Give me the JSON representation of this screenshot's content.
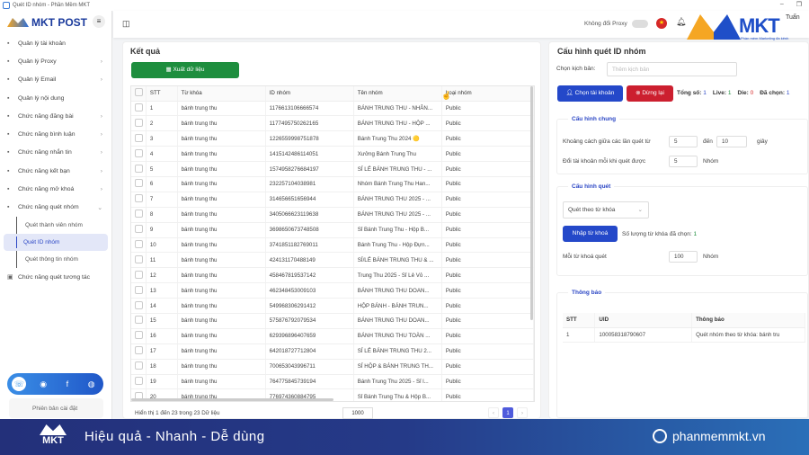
{
  "window": {
    "title": "Quét ID nhóm - Phần Mềm MKT",
    "minimize": "–",
    "restore": "❐"
  },
  "sidebar": {
    "logo": "MKT POST",
    "items": [
      {
        "label": "Quản lý tài khoản",
        "icon": "grid-icon",
        "chevron": false
      },
      {
        "label": "Quản lý Proxy",
        "icon": "gear-icon",
        "chevron": true
      },
      {
        "label": "Quản lý Email",
        "icon": "mail-icon",
        "chevron": true
      },
      {
        "label": "Quản lý nội dung",
        "icon": "content-icon",
        "chevron": false
      },
      {
        "label": "Chức năng đăng bài",
        "icon": "post-icon",
        "chevron": true
      },
      {
        "label": "Chức năng bình luận",
        "icon": "comment-icon",
        "chevron": true
      },
      {
        "label": "Chức năng nhắn tin",
        "icon": "message-icon",
        "chevron": true
      },
      {
        "label": "Chức năng kết bạn",
        "icon": "add-friend-icon",
        "chevron": true
      },
      {
        "label": "Chức năng mở khoá",
        "icon": "unlock-icon",
        "chevron": true
      },
      {
        "label": "Chức năng quét nhóm",
        "icon": "group-icon",
        "chevron": "down"
      }
    ],
    "subitems": [
      "Quét thành viên nhóm",
      "Quét ID nhóm",
      "Quét thông tin nhóm"
    ],
    "active_subitem": "Quét ID nhóm",
    "last_item": "Chức năng quét tương tác",
    "version_label": "Phiên bản cài đặt"
  },
  "topbar": {
    "proxy_label": "Không đổi Proxy",
    "proxy_toggle": false,
    "brand": "MKT",
    "brand_sub": "Phần mềm Marketing đa kênh",
    "user": "Tuấn"
  },
  "results": {
    "title": "Kết quả",
    "export_label": "Xuất dữ liệu",
    "columns": [
      "STT",
      "Từ khóa",
      "ID nhóm",
      "Tên nhóm",
      "Loại nhóm"
    ],
    "rows": [
      [
        "1",
        "bánh trung thu",
        "1176613106666574",
        "BÁNH TRUNG THU - NHÂN...",
        "Public"
      ],
      [
        "2",
        "bánh trung thu",
        "1177495750262165",
        "BÁNH TRUNG THU - HỘP ...",
        "Public"
      ],
      [
        "3",
        "bánh trung thu",
        "1226559998751878",
        "Bánh Trung Thu 2024 🟡",
        "Public"
      ],
      [
        "4",
        "bánh trung thu",
        "1415142486114051",
        "Xưởng Bánh Trung Thu",
        "Public"
      ],
      [
        "5",
        "bánh trung thu",
        "1574958276684197",
        "SỈ LẺ BÁNH TRUNG THU - ...",
        "Public"
      ],
      [
        "6",
        "bánh trung thu",
        "232257104038981",
        "Nhóm Bánh Trung Thu Han...",
        "Public"
      ],
      [
        "7",
        "bánh trung thu",
        "314656651656944",
        "BÁNH TRUNG THU 2025 - ...",
        "Public"
      ],
      [
        "8",
        "bánh trung thu",
        "3405066623119638",
        "BÁNH TRUNG THU 2025 - ...",
        "Public"
      ],
      [
        "9",
        "bánh trung thu",
        "3698650673748508",
        "Sỉ Bánh Trung Thu - Hộp B...",
        "Public"
      ],
      [
        "10",
        "bánh trung thu",
        "374185118276901​1",
        "Bánh Trung Thu - Hộp Đựn...",
        "Public"
      ],
      [
        "11",
        "bánh trung thu",
        "424131170488149",
        "SỈ/LẺ BÁNH TRUNG THU & ...",
        "Public"
      ],
      [
        "12",
        "bánh trung thu",
        "458467819537142",
        "Trung Thu 2025 - Sỉ Lẻ Vỏ ...",
        "Public"
      ],
      [
        "13",
        "bánh trung thu",
        "462348453009103",
        "BÁNH TRUNG THU DOAN...",
        "Public"
      ],
      [
        "14",
        "bánh trung thu",
        "549968306291412",
        "HỘP BÁNH - BÁNH TRUN...",
        "Public"
      ],
      [
        "15",
        "bánh trung thu",
        "575876792079534",
        "BÁNH TRUNG THU DOAN...",
        "Public"
      ],
      [
        "16",
        "bánh trung thu",
        "629396896407659",
        "BÁNH TRUNG THU TOÀN ...",
        "Public"
      ],
      [
        "17",
        "bánh trung thu",
        "642018727712804",
        "SỈ LẺ BÁNH TRUNG THU 2...",
        "Public"
      ],
      [
        "18",
        "bánh trung thu",
        "700653043996711",
        "SỈ HỘP & BÁNH TRUNG TH...",
        "Public"
      ],
      [
        "19",
        "bánh trung thu",
        "764775845739194",
        "Bánh Trung Thu 2025 - Sỉ l...",
        "Public"
      ],
      [
        "20",
        "bánh trung thu",
        "776974360884795",
        "Sỉ Bánh Trung Thu & Hộp B...",
        "Public"
      ]
    ],
    "footer": "Hiển thị 1 đến 23 trong 23 Dữ liệu",
    "page_size": "1000",
    "current_page": "1",
    "prev": "‹",
    "next": "›"
  },
  "config": {
    "title": "Cấu hình quét ID nhóm",
    "script_label": "Chọn kịch bản:",
    "script_placeholder": "Thêm kịch bản",
    "choose_account": "Chọn tài khoản",
    "stop": "Dừng lại",
    "stats": [
      {
        "label": "Tổng số:",
        "value": "1",
        "color": "#2c47c5"
      },
      {
        "label": "Live:",
        "value": "1",
        "color": "#1e8e3e"
      },
      {
        "label": "Die:",
        "value": "0",
        "color": "#d62828"
      },
      {
        "label": "Đã chọn:",
        "value": "1",
        "color": "#2c47c5"
      }
    ],
    "general": {
      "title": "Cấu hình chung",
      "interval_label": "Khoảng cách giữa các lần quét từ",
      "interval_from": "5",
      "to_label": "đến",
      "interval_to": "10",
      "seconds": "giây",
      "switch_label": "Đổi tài khoản mỗi khi quét được",
      "switch_value": "5",
      "groups": "Nhóm"
    },
    "scan": {
      "title": "Cấu hình quét",
      "mode": "Quét theo từ khóa",
      "import_label": "Nhập từ khoá",
      "keyword_count_label": "Số lượng từ khóa đã chọn:",
      "keyword_count": "1",
      "per_keyword_label": "Mỗi từ khoá quét",
      "per_keyword_value": "100",
      "groups": "Nhóm"
    }
  },
  "notify": {
    "title": "Thông báo",
    "columns": [
      "STT",
      "UID",
      "Thông báo"
    ],
    "rows": [
      [
        "1",
        "100058318790607",
        "Quét nhóm theo từ khóa: bánh tru"
      ]
    ]
  },
  "banner": {
    "logo": "MKT",
    "slogan": "Hiệu quả - Nhanh - Dễ dùng",
    "site": "phanmemmkt.vn"
  }
}
